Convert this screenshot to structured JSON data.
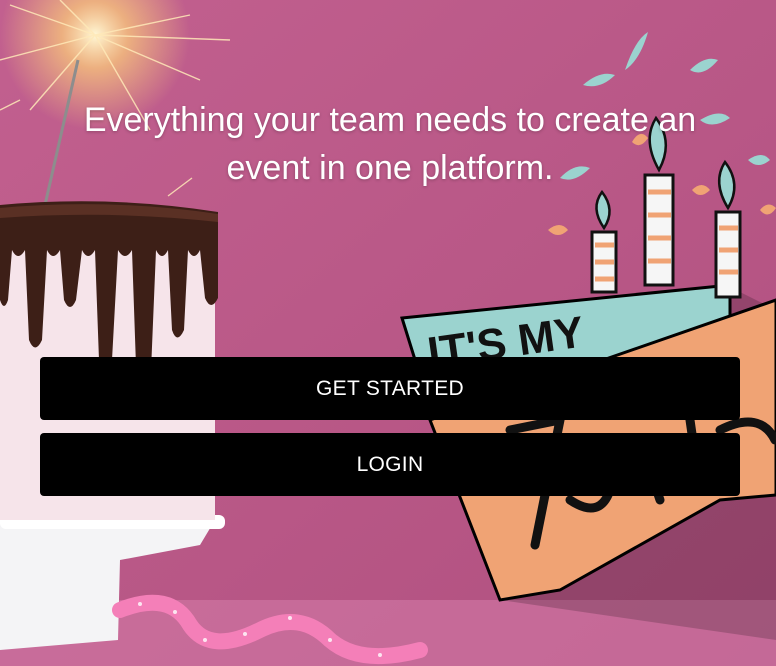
{
  "hero": {
    "headline_line1": "Everything your team needs to create an",
    "headline_line2": "event in one platform."
  },
  "actions": {
    "get_started_label": "GET STARTED",
    "login_label": "LOGIN"
  },
  "background": {
    "sign_text": "IT'S MY",
    "colors": {
      "pink": "#b9578a",
      "cake_frosting": "#f3dbe3",
      "chocolate": "#3d1f17",
      "sign_teal": "#9bd3cf",
      "sign_orange": "#f0a374",
      "button": "#000000"
    }
  }
}
